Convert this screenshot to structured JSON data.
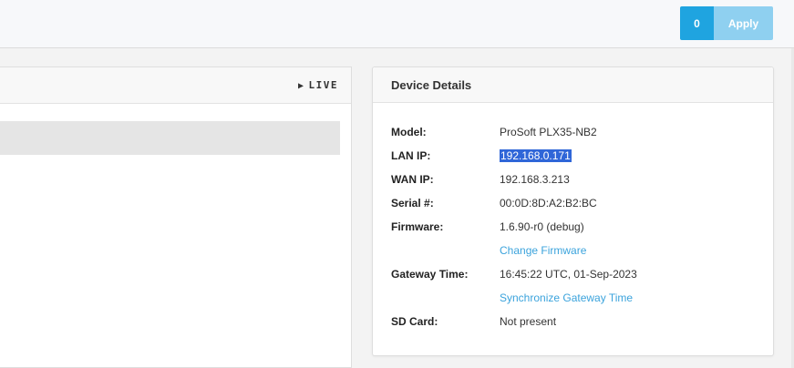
{
  "toolbar": {
    "pending_count": "0",
    "apply_label": "Apply"
  },
  "left_panel": {
    "live_label": "LIVE"
  },
  "device_details": {
    "title": "Device Details",
    "rows": {
      "model": {
        "label": "Model:",
        "value": "ProSoft PLX35-NB2"
      },
      "lan_ip": {
        "label": "LAN IP:",
        "value": "192.168.0.171"
      },
      "wan_ip": {
        "label": "WAN IP:",
        "value": "192.168.3.213"
      },
      "serial": {
        "label": "Serial #:",
        "value": "00:0D:8D:A2:B2:BC"
      },
      "firmware": {
        "label": "Firmware:",
        "value": "1.6.90-r0 (debug)"
      },
      "gateway_time": {
        "label": "Gateway Time:",
        "value": "16:45:22 UTC, 01-Sep-2023"
      },
      "sd_card": {
        "label": "SD Card:",
        "value": "Not present"
      }
    },
    "change_firmware_link": "Change Firmware",
    "sync_time_link": "Synchronize Gateway Time"
  },
  "colors": {
    "accent": "#1fa4e0",
    "apply_bg": "#8fd0f0",
    "link": "#3ba3dc",
    "selection": "#2f66d8"
  }
}
